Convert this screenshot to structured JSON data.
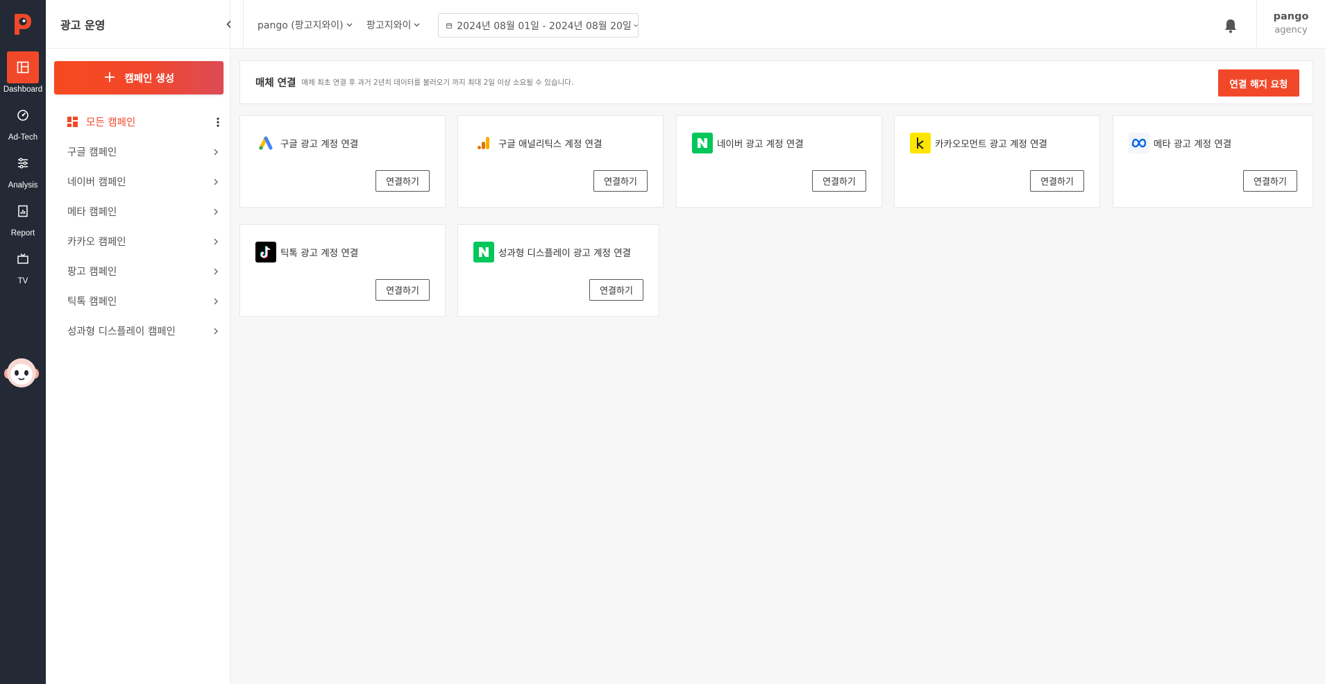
{
  "rail": {
    "items": [
      {
        "label": "Dashboard",
        "icon": "dashboard-icon"
      },
      {
        "label": "Ad-Tech",
        "icon": "gauge-icon"
      },
      {
        "label": "Analysis",
        "icon": "sliders-icon"
      },
      {
        "label": "Report",
        "icon": "report-icon"
      },
      {
        "label": "TV",
        "icon": "tv-icon"
      }
    ],
    "accent": "#f1482a"
  },
  "sidebar": {
    "title": "광고 운영",
    "create_label": "캠페인 생성",
    "items": [
      {
        "label": "모든 캠페인",
        "active": true
      },
      {
        "label": "구글 캠페인"
      },
      {
        "label": "네이버 캠페인"
      },
      {
        "label": "메타 캠페인"
      },
      {
        "label": "카카오 캠페인"
      },
      {
        "label": "팡고 캠페인"
      },
      {
        "label": "틱톡 캠페인"
      },
      {
        "label": "성과형 디스플레이 캠페인"
      }
    ]
  },
  "header": {
    "account": "pango (팡고지와이)",
    "brand": "팡고지와이",
    "date_range": "2024년 08월 01일 - 2024년 08월 20일",
    "user_name": "pango",
    "user_role": "agency"
  },
  "banner": {
    "title": "매체 연결",
    "description": "매체 최초 연결 후 과거 2년치 데이터를 불러오기 까지 최대 2일 이상 소요될 수 있습니다.",
    "disconnect_label": "연결 해지 요청"
  },
  "connect_label": "연결하기",
  "media": [
    {
      "title": "구글 광고 계정 연결",
      "icon": "google-ads-icon"
    },
    {
      "title": "구글 애널리틱스 계정 연결",
      "icon": "google-analytics-icon"
    },
    {
      "title": "네이버 광고 계정 연결",
      "icon": "naver-icon",
      "color": "#03c75a"
    },
    {
      "title": "카카오모먼트 광고 계정 연결",
      "icon": "kakao-icon",
      "color": "#fee500"
    },
    {
      "title": "메타 광고 계정 연결",
      "icon": "meta-icon",
      "color": "#0668e1"
    },
    {
      "title": "틱톡 광고 계정 연결",
      "icon": "tiktok-icon",
      "color": "#000000"
    },
    {
      "title": "성과형 디스플레이 광고 계정 연결",
      "icon": "naver-display-icon",
      "color": "#03c75a"
    }
  ]
}
